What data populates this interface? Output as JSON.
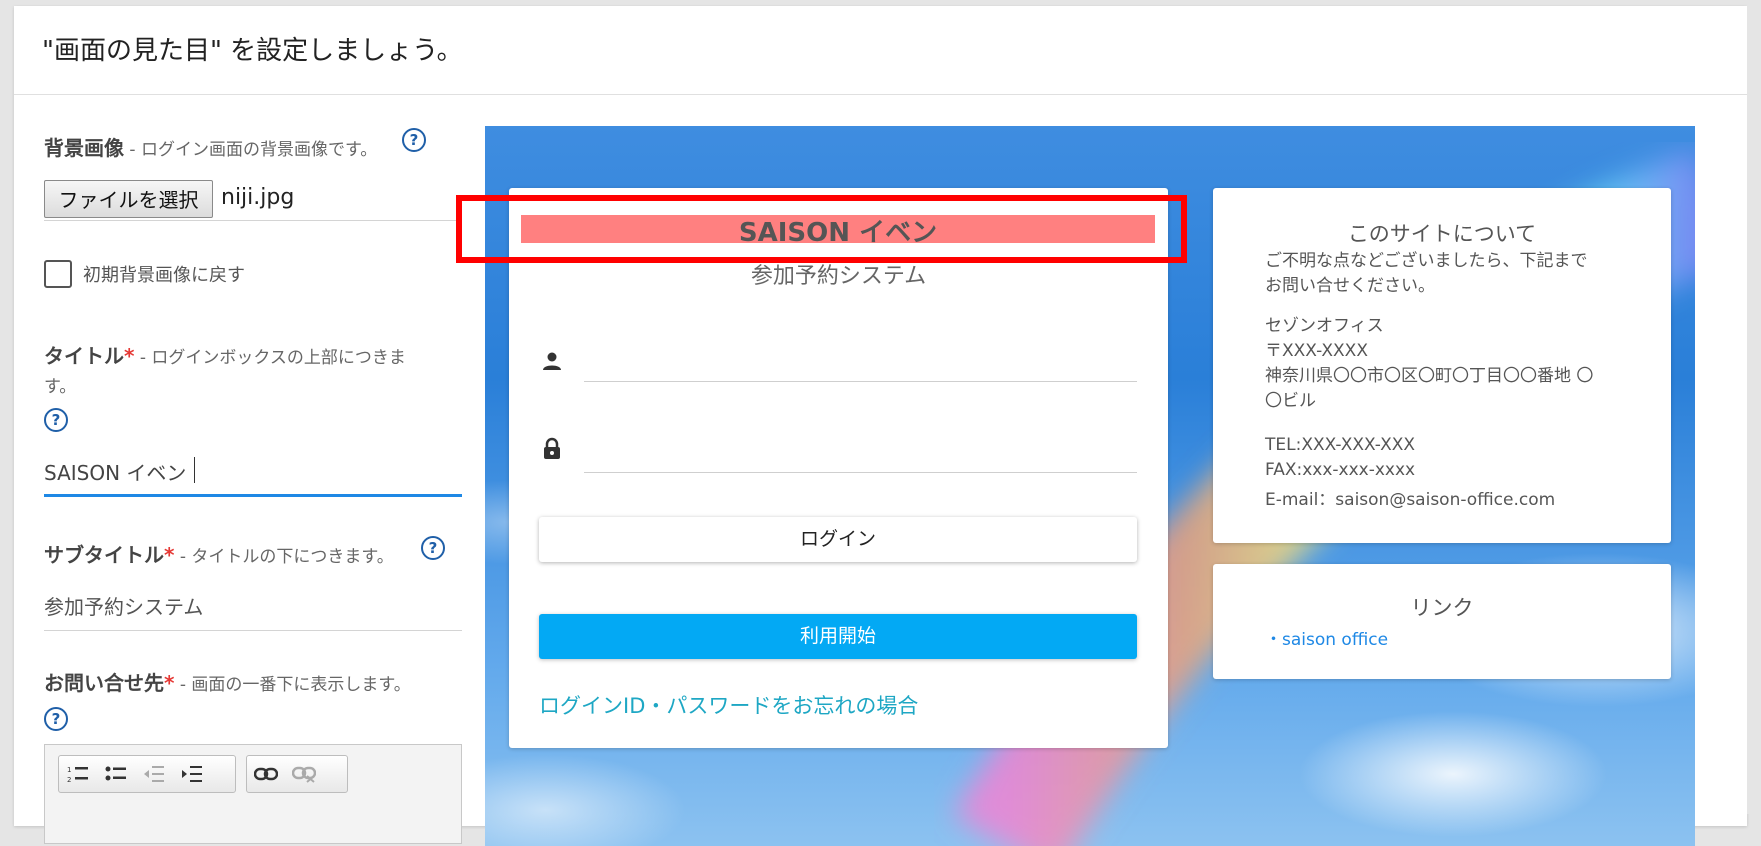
{
  "page": {
    "title": "\"画面の見た目\" を設定しましょう。"
  },
  "background_image": {
    "label": "背景画像",
    "desc": "- ログイン画面の背景画像です。",
    "file_button": "ファイルを選択",
    "file_name": "niji.jpg",
    "reset_label": "初期背景画像に戻す",
    "reset_checked": false
  },
  "title_field": {
    "label": "タイトル",
    "required": "*",
    "desc_line1": "- ログインボックスの上部につきま",
    "desc_line2": "す。",
    "value": "SAISON イベン"
  },
  "subtitle_field": {
    "label": "サブタイトル",
    "required": "*",
    "desc": "- タイトルの下につきます。",
    "value": "参加予約システム"
  },
  "contact_field": {
    "label": "お問い合せ先",
    "required": "*",
    "desc": "- 画面の一番下に表示します。",
    "toolbar": [
      "ordered-list-icon",
      "bullet-list-icon",
      "outdent-icon",
      "indent-icon",
      "link-icon",
      "unlink-icon"
    ]
  },
  "help_icon": "?",
  "preview": {
    "login_title": "SAISON イベン",
    "login_subtitle": "参加予約システム",
    "login_button": "ログイン",
    "start_button": "利用開始",
    "forgot_link": "ログインID・パスワードをお忘れの場合",
    "about": {
      "title": "このサイトについて",
      "lines": [
        "ご不明な点などございましたら、下記まで",
        "お問い合せください。",
        "セゾンオフィス",
        "〒XXX-XXXX",
        "神奈川県〇〇市〇区〇町〇丁目〇〇番地 〇",
        "〇ビル",
        "TEL:XXX-XXX-XXX",
        "FAX:xxx-xxx-xxxx",
        "E-mail：saison@saison-office.com"
      ]
    },
    "links": {
      "title": "リンク",
      "items": [
        "・saison office"
      ]
    }
  },
  "colors": {
    "accent": "#1e88e5",
    "required": "#e53935",
    "start_button": "#03a9f4",
    "annotation": "#ff0000",
    "title_highlight": "#ff8080"
  }
}
